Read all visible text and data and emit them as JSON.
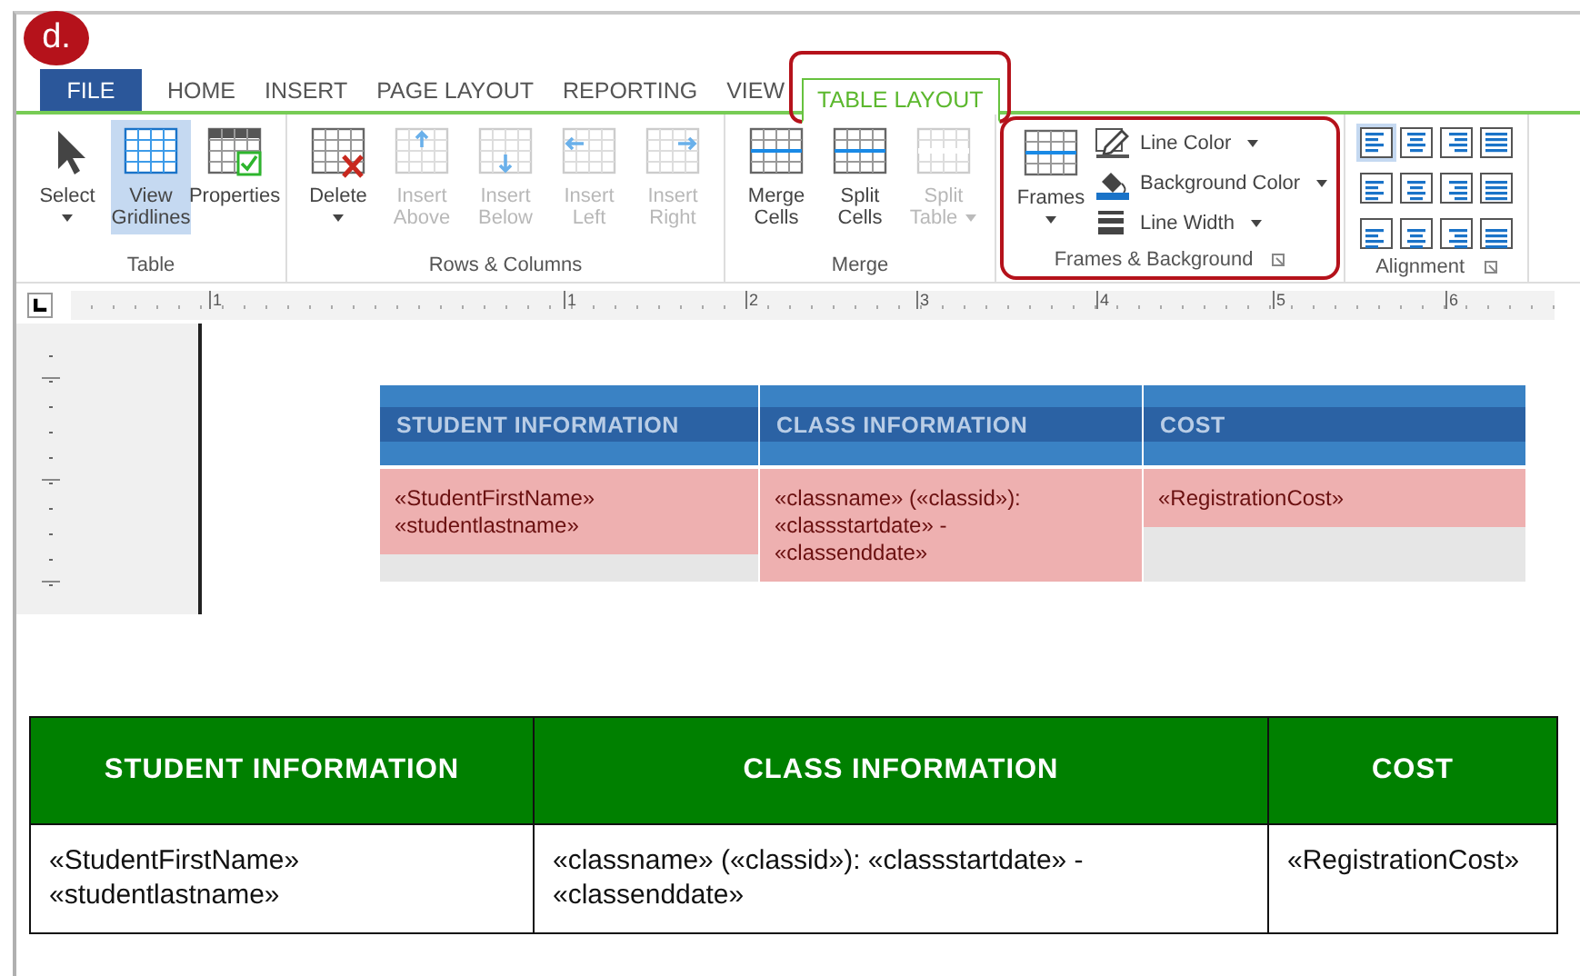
{
  "badge": "d.",
  "tabs": [
    {
      "label": "FILE",
      "kind": "file",
      "selected": false,
      "highlighted": false
    },
    {
      "label": "HOME",
      "kind": "tab",
      "selected": false,
      "highlighted": false
    },
    {
      "label": "INSERT",
      "kind": "tab",
      "selected": false,
      "highlighted": false
    },
    {
      "label": "PAGE LAYOUT",
      "kind": "tab",
      "selected": false,
      "highlighted": false
    },
    {
      "label": "REPORTING",
      "kind": "tab",
      "selected": false,
      "highlighted": false
    },
    {
      "label": "VIEW",
      "kind": "tab",
      "selected": false,
      "highlighted": false
    },
    {
      "label": "TABLE LAYOUT",
      "kind": "tab",
      "selected": true,
      "highlighted": true
    }
  ],
  "ribbon": [
    {
      "name": "Table",
      "highlighted": false,
      "launcher": false,
      "items": [
        {
          "kind": "select",
          "label": "Select",
          "dropdown": true,
          "disabled": false,
          "selected": false
        },
        {
          "kind": "gridlines",
          "label": "View Gridlines",
          "dropdown": false,
          "disabled": false,
          "selected": true
        },
        {
          "kind": "properties",
          "label": "Properties",
          "dropdown": false,
          "disabled": false,
          "selected": false
        }
      ]
    },
    {
      "name": "Rows & Columns",
      "highlighted": false,
      "launcher": false,
      "items": [
        {
          "kind": "delete",
          "label": "Delete",
          "dropdown": true,
          "disabled": false,
          "selected": false
        },
        {
          "kind": "insert-above",
          "label": "Insert Above",
          "dropdown": false,
          "disabled": true,
          "selected": false
        },
        {
          "kind": "insert-below",
          "label": "Insert Below",
          "dropdown": false,
          "disabled": true,
          "selected": false
        },
        {
          "kind": "insert-left",
          "label": "Insert Left",
          "dropdown": false,
          "disabled": true,
          "selected": false
        },
        {
          "kind": "insert-right",
          "label": "Insert Right",
          "dropdown": false,
          "disabled": true,
          "selected": false
        }
      ]
    },
    {
      "name": "Merge",
      "highlighted": false,
      "launcher": false,
      "items": [
        {
          "kind": "merge",
          "label": "Merge Cells",
          "dropdown": false,
          "disabled": false,
          "selected": false
        },
        {
          "kind": "split",
          "label": "Split Cells",
          "dropdown": false,
          "disabled": false,
          "selected": false
        },
        {
          "kind": "split-table",
          "label": "Split Table",
          "dropdown": true,
          "disabled": true,
          "selected": false
        }
      ]
    },
    {
      "name": "Frames & Background",
      "highlighted": true,
      "launcher": true,
      "items": [
        {
          "kind": "frames",
          "label": "Frames",
          "dropdown": true,
          "disabled": false,
          "selected": false
        }
      ],
      "small_items": [
        {
          "kind": "line-color",
          "label": "Line Color",
          "dropdown": true
        },
        {
          "kind": "background-color",
          "label": "Background Color",
          "dropdown": true
        },
        {
          "kind": "line-width",
          "label": "Line Width",
          "dropdown": true
        }
      ]
    },
    {
      "name": "Alignment",
      "highlighted": false,
      "launcher": true,
      "align_options": [
        {
          "selected": true
        },
        {
          "selected": false
        },
        {
          "selected": false
        },
        {
          "selected": false
        },
        {
          "selected": false
        },
        {
          "selected": false
        },
        {
          "selected": false
        },
        {
          "selected": false
        },
        {
          "selected": false
        },
        {
          "selected": false
        },
        {
          "selected": false
        },
        {
          "selected": false
        }
      ]
    }
  ],
  "ruler": {
    "labels": [
      "1",
      "1",
      "2",
      "3",
      "4",
      "5",
      "6"
    ]
  },
  "editor_table": {
    "columns": [
      "STUDENT INFORMATION",
      "CLASS INFORMATION",
      "COST"
    ],
    "cells": [
      "«StudentFirstName» «studentlastname»",
      "«classname» («classid»): «classstartdate» - «classenddate»",
      "«RegistrationCost»"
    ]
  },
  "output_table": {
    "columns": [
      "STUDENT INFORMATION",
      "CLASS INFORMATION",
      "COST"
    ],
    "cells": [
      "«StudentFirstName» «studentlastname»",
      "«classname» («classid»):  «classstartdate» - «classenddate»",
      "«RegistrationCost»"
    ]
  }
}
